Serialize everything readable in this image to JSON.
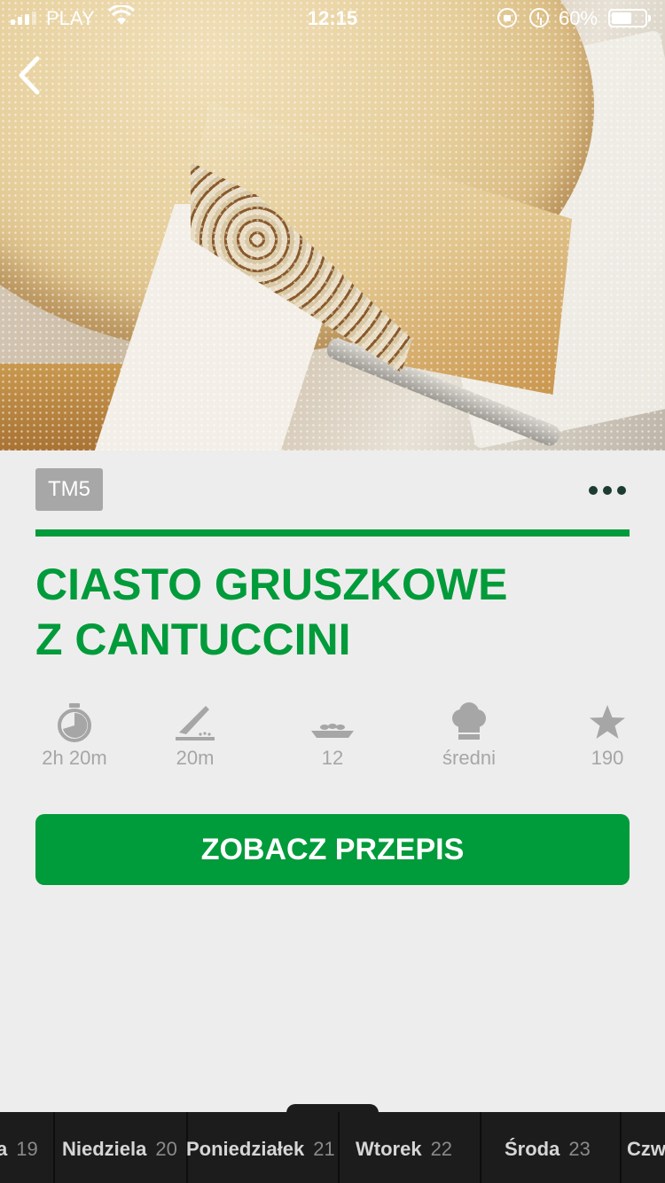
{
  "status_bar": {
    "carrier": "PLAY",
    "time": "12:15",
    "battery_percent": "60%",
    "battery_level": 0.6
  },
  "recipe": {
    "badge": "TM5",
    "title_line1": "CIASTO GRUSZKOWE",
    "title_line2": "Z CANTUCCINI",
    "stats": {
      "total_time": "2h 20m",
      "prep_time": "20m",
      "servings": "12",
      "difficulty": "średni",
      "rating_count": "190"
    },
    "cta_label": "ZOBACZ PRZEPIS"
  },
  "icons": {
    "back": "chevron-left-icon",
    "more": "more-dots-icon",
    "total_time": "stopwatch-icon",
    "prep_time": "knife-board-icon",
    "servings": "plate-icon",
    "difficulty": "chef-hat-icon",
    "rating": "star-icon"
  },
  "colors": {
    "brand_green": "#009b3a",
    "meta_gray": "#a6a6a6",
    "daybar": "#1c1c1c"
  },
  "day_bar": {
    "items": [
      {
        "name": "a",
        "num": "19"
      },
      {
        "name": "Niedziela",
        "num": "20"
      },
      {
        "name": "Poniedziałek",
        "num": "21"
      },
      {
        "name": "Wtorek",
        "num": "22"
      },
      {
        "name": "Środa",
        "num": "23"
      },
      {
        "name": "Czw",
        "num": ""
      }
    ]
  }
}
